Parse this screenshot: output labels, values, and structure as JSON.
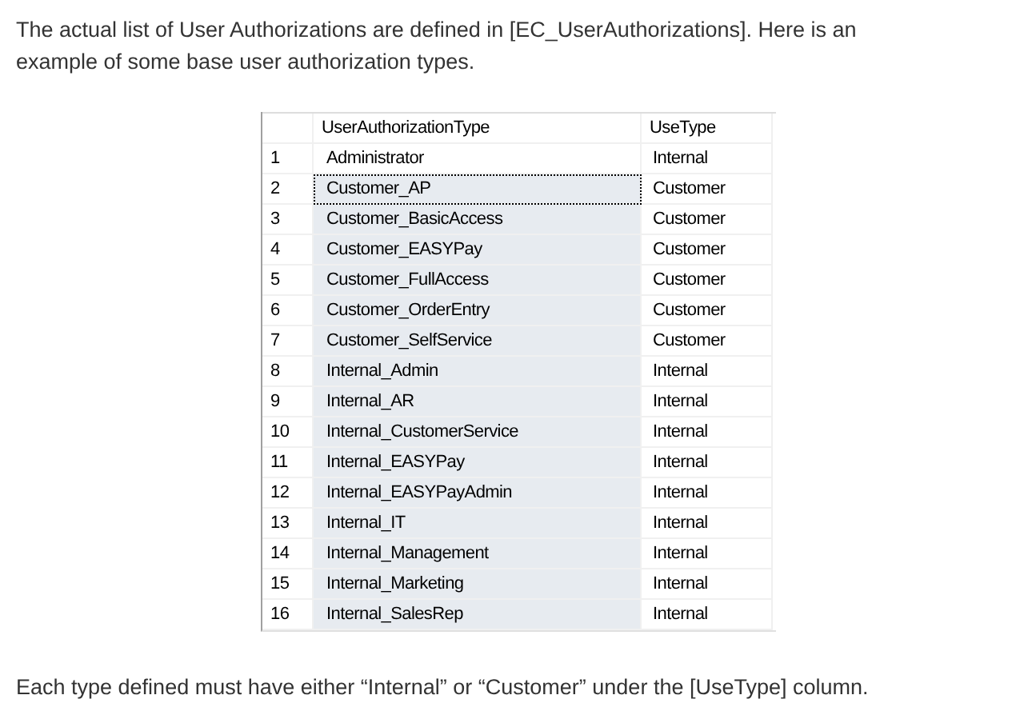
{
  "intro": "The actual list of User Authorizations are defined in [EC_UserAuthorizations]. Here is an example of some base user authorization types.",
  "table": {
    "columns": [
      "UserAuthorizationType",
      "UseType"
    ],
    "rows": [
      {
        "number": "1",
        "type": "Administrator",
        "use_type": "Internal",
        "selected": false,
        "focused": false
      },
      {
        "number": "2",
        "type": "Customer_AP",
        "use_type": "Customer",
        "selected": true,
        "focused": true
      },
      {
        "number": "3",
        "type": "Customer_BasicAccess",
        "use_type": "Customer",
        "selected": true,
        "focused": false
      },
      {
        "number": "4",
        "type": "Customer_EASYPay",
        "use_type": "Customer",
        "selected": true,
        "focused": false
      },
      {
        "number": "5",
        "type": "Customer_FullAccess",
        "use_type": "Customer",
        "selected": true,
        "focused": false
      },
      {
        "number": "6",
        "type": "Customer_OrderEntry",
        "use_type": "Customer",
        "selected": true,
        "focused": false
      },
      {
        "number": "7",
        "type": "Customer_SelfService",
        "use_type": "Customer",
        "selected": true,
        "focused": false
      },
      {
        "number": "8",
        "type": "Internal_Admin",
        "use_type": "Internal",
        "selected": true,
        "focused": false
      },
      {
        "number": "9",
        "type": "Internal_AR",
        "use_type": "Internal",
        "selected": true,
        "focused": false
      },
      {
        "number": "10",
        "type": "Internal_CustomerService",
        "use_type": "Internal",
        "selected": true,
        "focused": false
      },
      {
        "number": "11",
        "type": "Internal_EASYPay",
        "use_type": "Internal",
        "selected": true,
        "focused": false
      },
      {
        "number": "12",
        "type": "Internal_EASYPayAdmin",
        "use_type": "Internal",
        "selected": true,
        "focused": false
      },
      {
        "number": "13",
        "type": "Internal_IT",
        "use_type": "Internal",
        "selected": true,
        "focused": false
      },
      {
        "number": "14",
        "type": "Internal_Management",
        "use_type": "Internal",
        "selected": true,
        "focused": false
      },
      {
        "number": "15",
        "type": "Internal_Marketing",
        "use_type": "Internal",
        "selected": true,
        "focused": false
      },
      {
        "number": "16",
        "type": "Internal_SalesRep",
        "use_type": "Internal",
        "selected": true,
        "focused": false
      }
    ]
  },
  "outro": "Each type defined must have either “Internal” or “Customer” under the [UseType] column."
}
